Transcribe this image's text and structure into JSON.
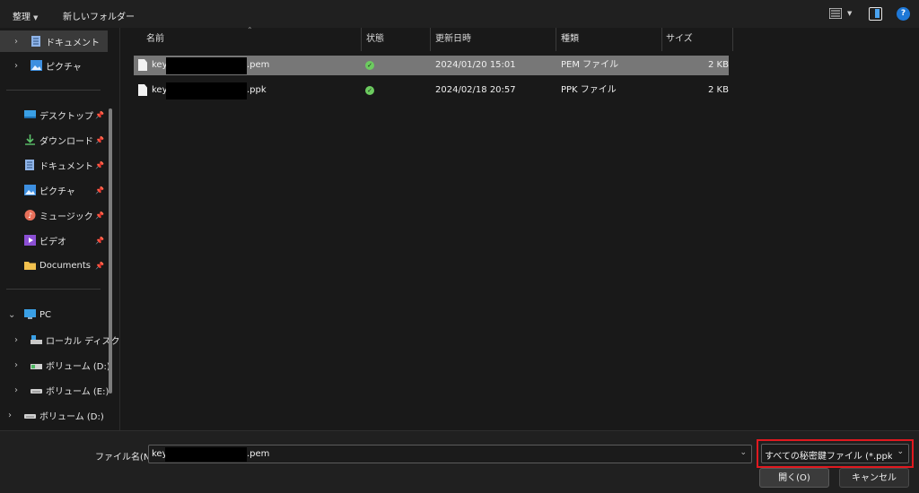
{
  "toolbar": {
    "organize_label": "整理",
    "new_folder_label": "新しいフォルダー",
    "view_icon": "view-list-icon",
    "preview_pane_icon": "preview-pane-icon",
    "help_icon_text": "?"
  },
  "sidebar": {
    "items": [
      {
        "label": "ドキュメント",
        "icon": "documents-icon",
        "selected": true
      },
      {
        "label": "ピクチャ",
        "icon": "pictures-icon"
      },
      {
        "label": "デスクトップ",
        "icon": "desktop-icon",
        "pinned": true
      },
      {
        "label": "ダウンロード",
        "icon": "download-icon",
        "pinned": true
      },
      {
        "label": "ドキュメント",
        "icon": "documents-icon",
        "pinned": true
      },
      {
        "label": "ピクチャ",
        "icon": "pictures-icon",
        "pinned": true
      },
      {
        "label": "ミュージック",
        "icon": "music-icon",
        "pinned": true
      },
      {
        "label": "ビデオ",
        "icon": "video-icon",
        "pinned": true
      },
      {
        "label": "Documents",
        "icon": "folder-icon",
        "pinned": true
      },
      {
        "label": "PC",
        "icon": "pc-icon",
        "expanded": true
      },
      {
        "label": "ローカル ディスク",
        "icon": "local-disk-icon"
      },
      {
        "label": "ボリューム (D:)",
        "icon": "usb-drive-icon"
      },
      {
        "label": "ボリューム (E:)",
        "icon": "drive-icon"
      },
      {
        "label": "ボリューム (D:)",
        "icon": "drive-icon"
      }
    ]
  },
  "filelist": {
    "columns": [
      "名前",
      "状態",
      "更新日時",
      "種類",
      "サイズ"
    ],
    "rows": [
      {
        "name_prefix": "key",
        "name_suffix": ".pem",
        "modified": "2024/01/20 15:01",
        "type": "PEM ファイル",
        "size": "2 KB",
        "selected": true
      },
      {
        "name_prefix": "key",
        "name_suffix": ".ppk",
        "modified": "2024/02/18 20:57",
        "type": "PPK ファイル",
        "size": "2 KB",
        "selected": false
      }
    ],
    "status_icon": "sync-ok-icon"
  },
  "footer": {
    "filename_label": "ファイル名(N):",
    "filename_prefix": "key",
    "filename_suffix": ".pem",
    "filter_value": "すべての秘密鍵ファイル (*.ppk;*.pem)",
    "open_label": "開く(O)",
    "cancel_label": "キャンセル",
    "highlight_color": "#e0191f"
  }
}
